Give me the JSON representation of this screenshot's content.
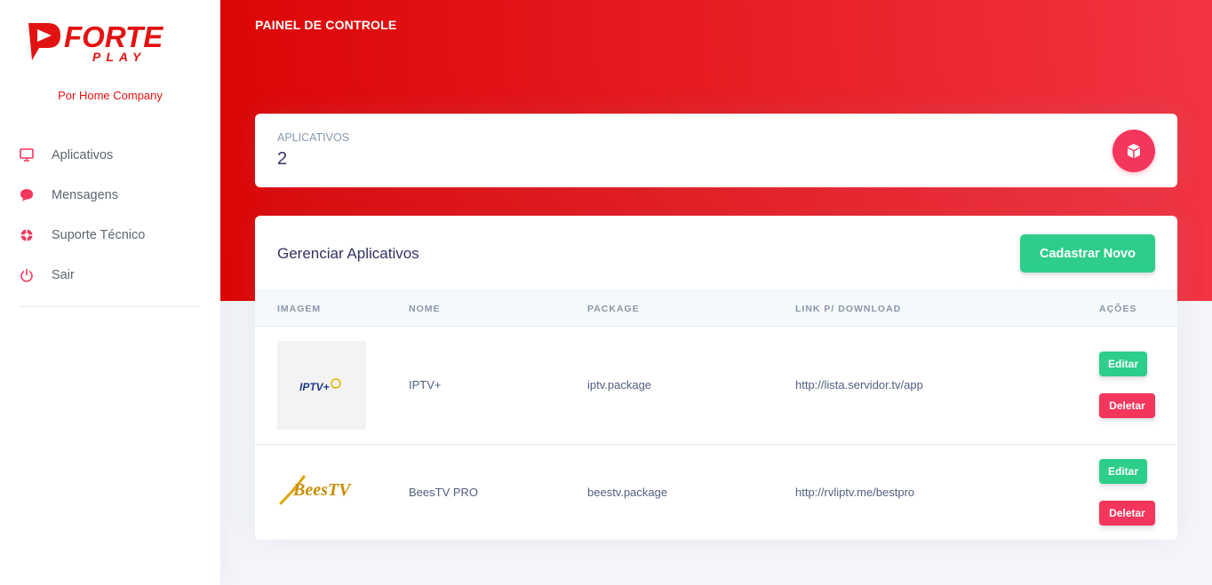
{
  "brand": {
    "logo_primary": "FORTE",
    "logo_secondary": "PLAY",
    "company": "Por Home Company",
    "accent": "#e31212"
  },
  "sidebar": {
    "items": [
      {
        "label": "Aplicativos",
        "icon": "monitor-icon"
      },
      {
        "label": "Mensagens",
        "icon": "chat-bubble-icon"
      },
      {
        "label": "Suporte Técnico",
        "icon": "lifebuoy-icon"
      },
      {
        "label": "Sair",
        "icon": "power-icon"
      }
    ]
  },
  "header": {
    "title": "PAINEL DE CONTROLE"
  },
  "stats": {
    "label": "APLICATIVOS",
    "value": "2",
    "icon": "box-icon"
  },
  "apps": {
    "title": "Gerenciar Aplicativos",
    "new_button": "Cadastrar Novo",
    "columns": [
      "IMAGEM",
      "NOME",
      "PACKAGE",
      "LINK P/ DOWNLOAD",
      "AÇÕES"
    ],
    "rows": [
      {
        "logo_text": "IPTV+",
        "name": "IPTV+",
        "package": "iptv.package",
        "link": "http://lista.servidor.tv/app",
        "edit": "Editar",
        "delete": "Deletar"
      },
      {
        "logo_text": "BeesTV",
        "name": "BeesTV PRO",
        "package": "beestv.package",
        "link": "http://rvliptv.me/bestpro",
        "edit": "Editar",
        "delete": "Deletar"
      }
    ]
  },
  "colors": {
    "success": "#2dce89",
    "danger": "#f5365c",
    "header_start": "#dc0505",
    "header_end": "#f23442"
  }
}
